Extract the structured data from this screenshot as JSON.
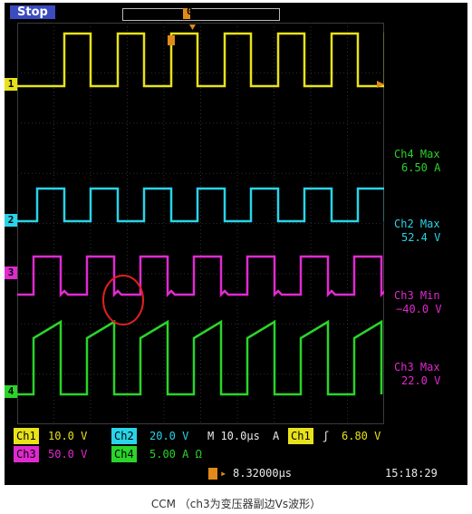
{
  "scope": {
    "run_state": "Stop",
    "trigger_position_label": "0",
    "channels": [
      {
        "id": "1",
        "color": "#e8e21a"
      },
      {
        "id": "2",
        "color": "#2ad4e8"
      },
      {
        "id": "3",
        "color": "#e02ad0"
      },
      {
        "id": "4",
        "color": "#2ad42a"
      }
    ],
    "measurements": [
      {
        "label": "Ch4 Max",
        "value": "6.50 A",
        "color": "#2ad42a"
      },
      {
        "label": "Ch2 Max",
        "value": "52.4 V",
        "color": "#2ad4e8"
      },
      {
        "label": "Ch3 Min",
        "value": "−40.0 V",
        "color": "#e02ad0"
      },
      {
        "label": "Ch3 Max",
        "value": "22.0 V",
        "color": "#e02ad0"
      }
    ],
    "status": {
      "ch1_label": "Ch1",
      "ch1_scale": "10.0 V",
      "ch2_label": "Ch2",
      "ch2_scale": "20.0 V",
      "timebase": "M 10.0µs",
      "trigger_mode": "A",
      "trigger_source": "Ch1",
      "trigger_slope": "ʃ",
      "trigger_level": "6.80 V",
      "ch3_label": "Ch3",
      "ch3_scale": "50.0 V",
      "ch4_label": "Ch4",
      "ch4_scale": "5.00 A Ω",
      "delay": "8.32000µs",
      "time": "15:18:29"
    }
  },
  "caption": "CCM （ch3为变压器副边Vs波形）"
}
